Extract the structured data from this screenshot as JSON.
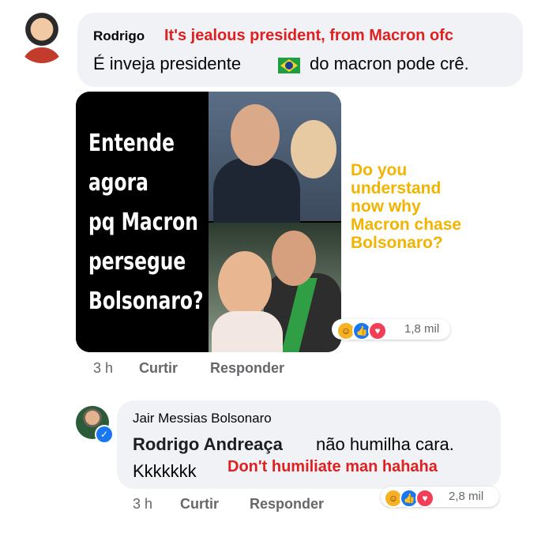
{
  "comment1": {
    "author": "Rodrigo",
    "translation": "It's jealous president, from Macron ofc",
    "text_before_flag": "É inveja presidente",
    "flag_icon": "brazil-flag",
    "text_after_flag": "do macron pode crê.",
    "meme_lines": [
      "Entende",
      "agora",
      "pq Macron",
      "persegue",
      "Bolsonaro?"
    ],
    "meme_overlay": [
      "Do you",
      "understand",
      "now why",
      "Macron chase",
      "Bolsonaro?"
    ],
    "reaction_icons": [
      "haha-icon",
      "like-icon",
      "love-icon"
    ],
    "reaction_count": "1,8 mil",
    "time": "3 h",
    "like_label": "Curtir",
    "reply_label": "Responder"
  },
  "comment2": {
    "author": "Jair Messias Bolsonaro",
    "mention": "Rodrigo Andreaça",
    "text_line1": "não humilha cara.",
    "text_line2": "Kkkkkkk",
    "translation": "Don't humiliate man hahaha",
    "reaction_icons": [
      "haha-icon",
      "like-icon",
      "love-icon"
    ],
    "reaction_count": "2,8 mil",
    "time": "3 h",
    "like_label": "Curtir",
    "reply_label": "Responder"
  },
  "colors": {
    "bubble": "#f0f2f5",
    "translation": "#e02020",
    "overlay": "#f2b400",
    "meta": "#65676b",
    "like": "#1877f2",
    "love": "#f33e58",
    "haha": "#f7b125"
  }
}
